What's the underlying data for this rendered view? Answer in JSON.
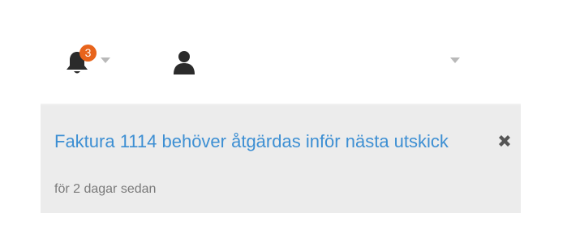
{
  "header": {
    "notifications": {
      "count": "3",
      "icon": "bell-icon",
      "badge_color": "#e8641c"
    },
    "user_menu": {
      "icon": "user-icon"
    }
  },
  "notification": {
    "title": "Faktura 1114 behöver åtgärdas inför nästa utskick",
    "time": "för 2 dagar sedan",
    "close_icon": "close-icon",
    "title_color": "#3d8fd3",
    "background": "#ececec"
  }
}
